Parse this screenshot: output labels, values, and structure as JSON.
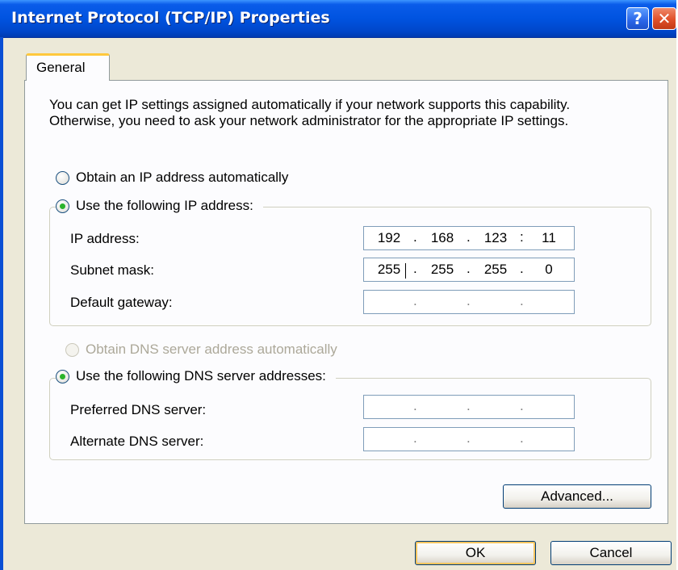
{
  "window": {
    "title": "Internet Protocol (TCP/IP) Properties",
    "help_glyph": "?",
    "close_glyph": "✕"
  },
  "tabs": [
    {
      "label": "General",
      "selected": true
    }
  ],
  "intro_text": "You can get IP settings assigned automatically if your network supports this capability. Otherwise, you need to ask your network administrator for the appropriate IP settings.",
  "ip_section": {
    "auto_label": "Obtain an IP address automatically",
    "auto_selected": false,
    "manual_label": "Use the following IP address:",
    "manual_selected": true,
    "ip_address_label": "IP address:",
    "ip_address": [
      "192",
      "168",
      "123",
      "11"
    ],
    "subnet_label": "Subnet mask:",
    "subnet": [
      "255",
      "255",
      "255",
      "0"
    ],
    "gateway_label": "Default gateway:",
    "gateway": [
      "",
      "",
      "",
      ""
    ]
  },
  "dns_section": {
    "auto_label": "Obtain DNS server address automatically",
    "auto_enabled": false,
    "manual_label": "Use the following DNS server addresses:",
    "manual_selected": true,
    "preferred_label": "Preferred DNS server:",
    "preferred": [
      "",
      "",
      "",
      ""
    ],
    "alternate_label": "Alternate DNS server:",
    "alternate": [
      "",
      "",
      "",
      ""
    ]
  },
  "buttons": {
    "advanced": "Advanced...",
    "ok": "OK",
    "cancel": "Cancel"
  },
  "colors": {
    "titlebar": "#0053e0",
    "dialog_bg": "#ece9d8",
    "panel_bg": "#fcfcfe",
    "radio_check": "#2bb32b",
    "tab_highlight": "#ffc83c"
  }
}
